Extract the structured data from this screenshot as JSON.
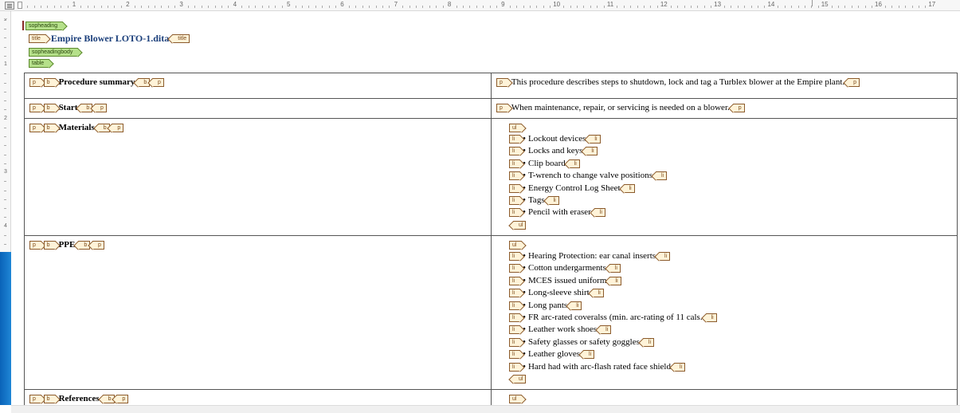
{
  "ruler": {
    "top_numbers": [
      "1",
      "2",
      "3",
      "4",
      "5",
      "6",
      "7",
      "8",
      "9",
      "10",
      "11",
      "12",
      "13",
      "14",
      "15",
      "16",
      "17"
    ],
    "left_numbers": [
      "1",
      "2",
      "3",
      "4",
      "5",
      "6",
      "7"
    ]
  },
  "document": {
    "root_tag": "sopheading",
    "title_open_tag": "title",
    "title_text": "Empire Blower LOTO-1.dita",
    "title_close_tag": "title",
    "body_tag": "sopheadingbody",
    "table_tag": "table"
  },
  "tags": {
    "p": "p",
    "b": "b",
    "ul": "ul",
    "li": "li"
  },
  "rows": [
    {
      "label": "Procedure summary",
      "text": "This procedure describes steps to shutdown, lock and tag a Turblex blower at the Empire plant."
    },
    {
      "label": "Start",
      "text": "When maintenance, repair, or servicing is needed on a blower."
    },
    {
      "label": "Materials",
      "items": [
        "Lockout devices",
        "Locks and keys",
        "Clip board",
        "T-wrench to change valve positions",
        "Energy Control Log Sheet",
        "Tags",
        "Pencil with eraser"
      ]
    },
    {
      "label": "PPE",
      "items": [
        "Hearing Protection: ear canal inserts",
        "Cotton undergarments",
        "MCES issued uniform",
        "Long-sleeve shirt",
        "Long pants",
        "FR arc-rated coveralss (min. arc-rating of 11 cals.",
        "Leather work shoes",
        "Safety glasses or safety goggles",
        "Leather gloves",
        "Hard had with arc-flash rated face shield"
      ]
    },
    {
      "label": "References"
    }
  ],
  "bullet_char": "•"
}
